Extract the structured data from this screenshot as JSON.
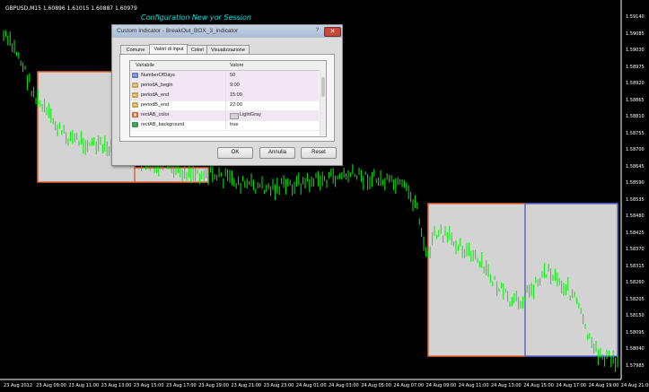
{
  "chart": {
    "symbol_info": "GBPUSD,M15 1.60896 1.61015 1.60887 1.60979",
    "session_title": "Configuration New yor Session",
    "price_labels": [
      "1.59140",
      "1.59085",
      "1.59030",
      "1.58975",
      "1.58920",
      "1.58865",
      "1.58810",
      "1.58755",
      "1.58700",
      "1.58645",
      "1.58590",
      "1.58535",
      "1.58480",
      "1.58425",
      "1.58370",
      "1.58315",
      "1.58260",
      "1.58205",
      "1.58150",
      "1.58095",
      "1.58040",
      "1.57985"
    ],
    "time_labels": [
      "23 Aug 2012",
      "23 Aug 09:00",
      "23 Aug 11:00",
      "23 Aug 13:00",
      "23 Aug 15:00",
      "23 Aug 17:00",
      "23 Aug 19:00",
      "23 Aug 21:00",
      "23 Aug 23:00",
      "24 Aug 01:00",
      "24 Aug 03:00",
      "24 Aug 05:00",
      "24 Aug 07:00",
      "24 Aug 09:00",
      "24 Aug 11:00",
      "24 Aug 13:00",
      "24 Aug 15:00",
      "24 Aug 17:00",
      "24 Aug 19:00",
      "24 Aug 21:00"
    ],
    "colors": {
      "background": "#000000",
      "bars": "#00ee00",
      "box_fill": "#d3d3d3",
      "box_a_border": "#e8693a",
      "box_b_border": "#5a6fd6"
    }
  },
  "dialog": {
    "title": "Custom Indicator - BreakOut_BOX_3_indicator",
    "help_label": "?",
    "close_label": "✕",
    "tabs": [
      "Comune",
      "Valori di input",
      "Colori",
      "Visualizzazione"
    ],
    "active_tab": "Valori di input",
    "columns": {
      "name": "Variabile",
      "value": "Valore"
    },
    "params": [
      {
        "icon": "123",
        "name": "NumberOfDays",
        "value": "50",
        "selected": true
      },
      {
        "icon": "ab",
        "name": "periodA_begin",
        "value": "9:00",
        "selected": true
      },
      {
        "icon": "ab",
        "name": "periodA_end",
        "value": "15:00",
        "selected": true
      },
      {
        "icon": "ab",
        "name": "periodB_end",
        "value": "22:00",
        "selected": false
      },
      {
        "icon": "clr",
        "name": "rectAB_color",
        "value": "LightGray",
        "selected": true
      },
      {
        "icon": "bool",
        "name": "rectAB_background",
        "value": "true",
        "selected": false
      }
    ],
    "buttons": {
      "ok": "OK",
      "cancel": "Annulla",
      "reset": "Reset"
    }
  }
}
